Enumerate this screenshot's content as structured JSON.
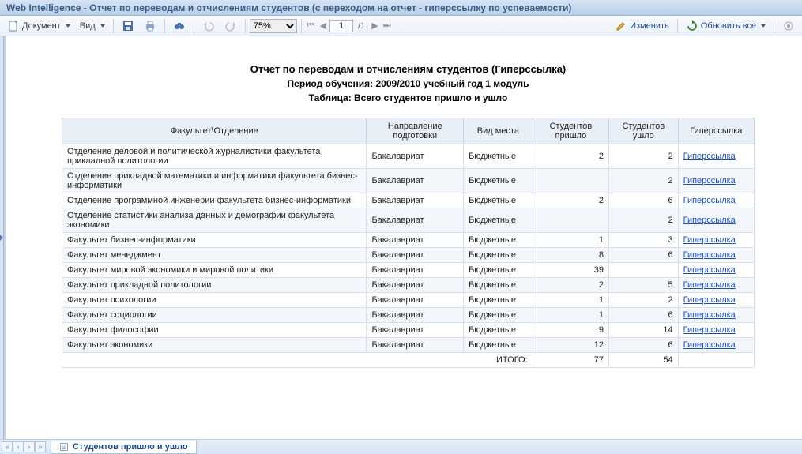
{
  "window": {
    "title": "Web Intelligence - Отчет по переводам и отчислениям студентов (с переходом на отчет - гиперссылку по успеваемости)"
  },
  "toolbar": {
    "document": "Документ",
    "view": "Вид",
    "zoom": "75%",
    "page_current": "1",
    "page_total": "/1",
    "edit": "Изменить",
    "refresh": "Обновить все"
  },
  "report": {
    "title": "Отчет по переводам и отчислениям студентов (Гиперссылка)",
    "period": "Период обучения:  2009/2010 учебный год 1 модуль",
    "table_caption": "Таблица:  Всего студентов пришло и ушло",
    "columns": {
      "c1": "Факультет\\Отделение",
      "c2": "Направление подготовки",
      "c3": "Вид места",
      "c4": "Студентов пришло",
      "c5": "Студентов ушло",
      "c6": "Гиперссылка"
    },
    "link_text": "Гиперссылка",
    "rows": [
      {
        "dept": "Отделение деловой и политической журналистики  факультета прикладной политологии",
        "dir": "Бакалавриат",
        "type": "Бюджетные",
        "in": "2",
        "out": "2"
      },
      {
        "dept": "Отделение прикладной математики и информатики факультета бизнес-информатики",
        "dir": "Бакалавриат",
        "type": "Бюджетные",
        "in": "",
        "out": "2"
      },
      {
        "dept": "Отделение программной инженерии факультета бизнес-информатики",
        "dir": "Бакалавриат",
        "type": "Бюджетные",
        "in": "2",
        "out": "6"
      },
      {
        "dept": "Отделение статистики анализа данных и демографии факультета экономики",
        "dir": "Бакалавриат",
        "type": "Бюджетные",
        "in": "",
        "out": "2"
      },
      {
        "dept": "Факультет бизнес-информатики",
        "dir": "Бакалавриат",
        "type": "Бюджетные",
        "in": "1",
        "out": "3"
      },
      {
        "dept": "Факультет менеджмент",
        "dir": "Бакалавриат",
        "type": "Бюджетные",
        "in": "8",
        "out": "6"
      },
      {
        "dept": "Факультет мировой экономики и мировой политики",
        "dir": "Бакалавриат",
        "type": "Бюджетные",
        "in": "39",
        "out": ""
      },
      {
        "dept": "Факультет прикладной политологии",
        "dir": "Бакалавриат",
        "type": "Бюджетные",
        "in": "2",
        "out": "5"
      },
      {
        "dept": "Факультет психологии",
        "dir": "Бакалавриат",
        "type": "Бюджетные",
        "in": "1",
        "out": "2"
      },
      {
        "dept": "Факультет социологии",
        "dir": "Бакалавриат",
        "type": "Бюджетные",
        "in": "1",
        "out": "6"
      },
      {
        "dept": "Факультет философии",
        "dir": "Бакалавриат",
        "type": "Бюджетные",
        "in": "9",
        "out": "14"
      },
      {
        "dept": "Факультет экономики",
        "dir": "Бакалавриат",
        "type": "Бюджетные",
        "in": "12",
        "out": "6"
      }
    ],
    "total": {
      "label": "ИТОГО:",
      "in": "77",
      "out": "54"
    }
  },
  "tabs": {
    "active": "Студентов пришло и ушло"
  }
}
